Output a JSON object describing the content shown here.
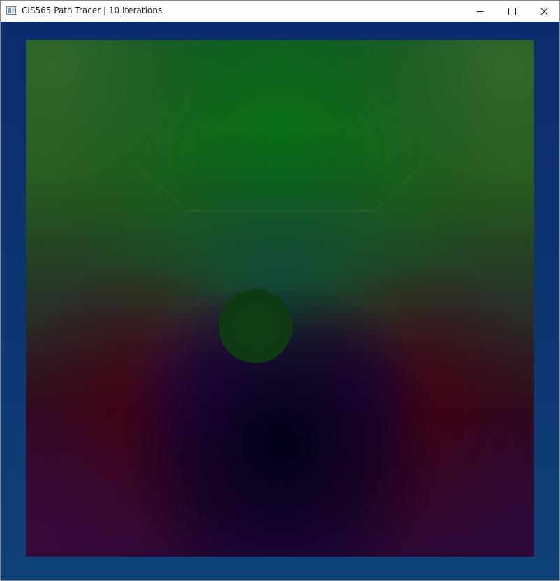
{
  "window": {
    "title": "CIS565 Path Tracer | 10 Iterations"
  },
  "controls": {
    "minimize_icon": "minimize-icon",
    "maximize_icon": "maximize-icon",
    "close_icon": "close-icon"
  },
  "colors": {
    "background": "#0b2f6f",
    "wall_green": "#00681f",
    "wall_red": "#3a0010",
    "floor_purple": "#2d0a3c",
    "sphere": "#0f3e12"
  }
}
